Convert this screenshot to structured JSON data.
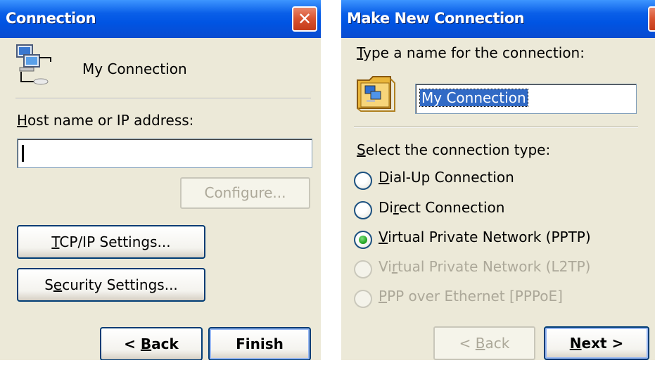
{
  "window1": {
    "title": "Connection",
    "close_glyph": "✕",
    "connection_name": "My Connection",
    "host_label_u": "H",
    "host_label_rest": "ost name or IP address:",
    "host_value": "",
    "configure_label": "Configure...",
    "tcpip_u": "T",
    "tcpip_rest": "CP/IP Settings...",
    "security_pre": "S",
    "security_u": "e",
    "security_rest": "curity Settings...",
    "back_pre": "< ",
    "back_u": "B",
    "back_rest": "ack",
    "finish_label": "Finish",
    "icon": "network-computers-icon"
  },
  "window2": {
    "title": "Make New Connection",
    "close_glyph": "✕",
    "name_prompt_u": "T",
    "name_prompt_rest": "ype a name for the connection:",
    "name_value": "My Connection",
    "type_prompt_u": "S",
    "type_prompt_rest": "elect the connection type:",
    "options": [
      {
        "pre": "",
        "u": "D",
        "rest": "ial-Up Connection",
        "checked": false,
        "enabled": true
      },
      {
        "pre": "Di",
        "u": "r",
        "rest": "ect Connection",
        "checked": false,
        "enabled": true
      },
      {
        "pre": "",
        "u": "V",
        "rest": "irtual Private Network (PPTP)",
        "checked": true,
        "enabled": true
      },
      {
        "pre": "Vi",
        "u": "r",
        "rest": "tual Private Network (L2TP)",
        "checked": false,
        "enabled": false
      },
      {
        "pre": "",
        "u": "P",
        "rest": "PP over Ethernet [PPPoE]",
        "checked": false,
        "enabled": false
      }
    ],
    "back_pre": "< ",
    "back_u": "B",
    "back_rest": "ack",
    "next_u": "N",
    "next_rest": "ext >",
    "icon": "connection-folder-icon"
  },
  "colors": {
    "titlebar": "#0054e3",
    "face": "#ece9d8",
    "selection": "#316ac5",
    "radio_check": "#27a827"
  }
}
